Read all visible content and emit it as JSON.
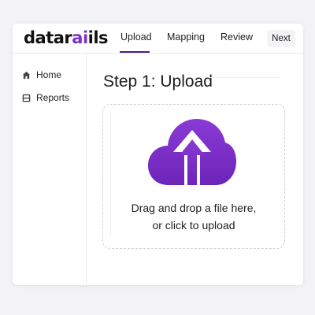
{
  "brand": {
    "logo_text_main": "datar",
    "logo_text_accent": "ai",
    "logo_text_end": "ils",
    "accent_color": "#7b2fc9"
  },
  "nav": {
    "tabs": [
      {
        "label": "Upload",
        "active": true
      },
      {
        "label": "Mapping",
        "active": false
      },
      {
        "label": "Review",
        "active": false
      }
    ],
    "next_label": "Next"
  },
  "sidebar": {
    "items": [
      {
        "label": "Home",
        "icon": "home-icon"
      },
      {
        "label": "Reports",
        "icon": "reports-icon"
      }
    ]
  },
  "main": {
    "title": "Step 1: Upload",
    "dropzone": {
      "icon": "cloud-upload-icon",
      "line1": "Drag and drop a file here,",
      "line2": "or click to upload"
    }
  }
}
